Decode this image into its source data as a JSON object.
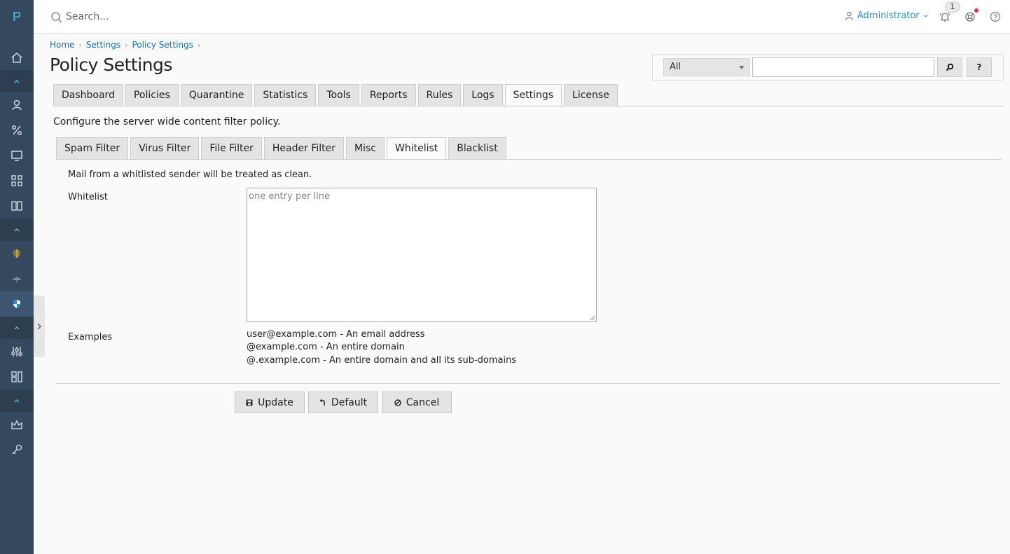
{
  "app": {
    "logo_letter": "P"
  },
  "topbar": {
    "search_placeholder": "Search...",
    "user_name": "Administrator",
    "notification_count": "1"
  },
  "breadcrumb": [
    "Home",
    "Settings",
    "Policy Settings"
  ],
  "page_title": "Policy Settings",
  "filter": {
    "selected": "All",
    "search_value": "",
    "search_button_icon": "search-icon",
    "help_label": "?"
  },
  "main_tabs": [
    "Dashboard",
    "Policies",
    "Quarantine",
    "Statistics",
    "Tools",
    "Reports",
    "Rules",
    "Logs",
    "Settings",
    "License"
  ],
  "main_tab_active": "Settings",
  "description": "Configure the server wide content filter policy.",
  "sub_tabs": [
    "Spam Filter",
    "Virus Filter",
    "File Filter",
    "Header Filter",
    "Misc",
    "Whitelist",
    "Blacklist"
  ],
  "sub_tab_active": "Whitelist",
  "whitelist": {
    "info": "Mail from a whitlisted sender will be treated as clean.",
    "label": "Whitelist",
    "placeholder": "one entry per line",
    "value": "",
    "examples_label": "Examples",
    "examples": [
      "user@example.com - An email address",
      "@example.com - An entire domain",
      "@.example.com - An entire domain and all its sub-domains"
    ]
  },
  "buttons": {
    "update": "Update",
    "default": "Default",
    "cancel": "Cancel"
  },
  "colors": {
    "sidebar_bg": "#34495e",
    "sidebar_sep": "#2c3e50",
    "accent": "#2a8fc0",
    "link": "#1f6f9f"
  }
}
